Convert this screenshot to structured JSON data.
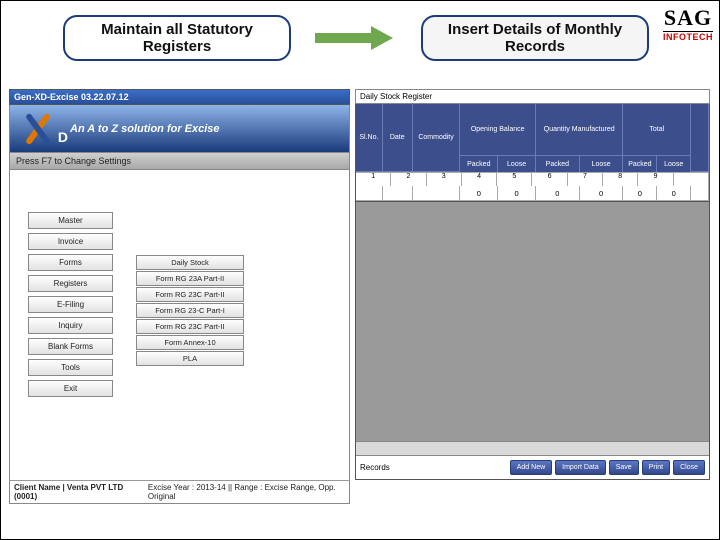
{
  "logo": {
    "top": "SAG",
    "sub": "INFOTECH"
  },
  "boxes": {
    "left": "Maintain all Statutory\nRegisters",
    "right": "Insert Details of Monthly\nRecords"
  },
  "left_panel": {
    "title": "Gen-XD-Excise 03.22.07.12",
    "banner": "An A to Z solution for Excise",
    "f7": "Press F7 to Change Settings",
    "main_menu": [
      "Master",
      "Invoice",
      "Forms",
      "Registers",
      "E-Filing",
      "Inquiry",
      "Blank Forms",
      "Tools",
      "Exit"
    ],
    "submenu": [
      "Daily Stock",
      "Form RG 23A Part-II",
      "Form RG 23C Part-II",
      "Form RG 23-C Part-I",
      "Form RG 23C Part-II",
      "Form Annex-10",
      "PLA"
    ],
    "status": {
      "client": "Client Name | Venta PVT LTD   (0001)",
      "year": "Excise Year : 2013-14 || Range : Excise Range, Opp. Original"
    }
  },
  "right_panel": {
    "title": "Daily Stock Register",
    "headers": {
      "cols": [
        "Sl.No.",
        "Date",
        "Commodity",
        "Opening Balance",
        "Quantity Manufactured",
        "Total",
        ""
      ],
      "subs": [
        "Packed",
        "Loose",
        "Packed",
        "Loose",
        "Packed",
        "Loose"
      ],
      "nums": [
        "1",
        "2",
        "3",
        "4",
        "5",
        "6",
        "7",
        "8",
        "9"
      ]
    },
    "row": [
      "",
      "",
      "",
      "0",
      "0",
      "0",
      "0",
      "0",
      "0"
    ],
    "footer_label": "Records",
    "buttons": [
      "Add New",
      "Import Data",
      "Save",
      "Print",
      "Close"
    ]
  }
}
